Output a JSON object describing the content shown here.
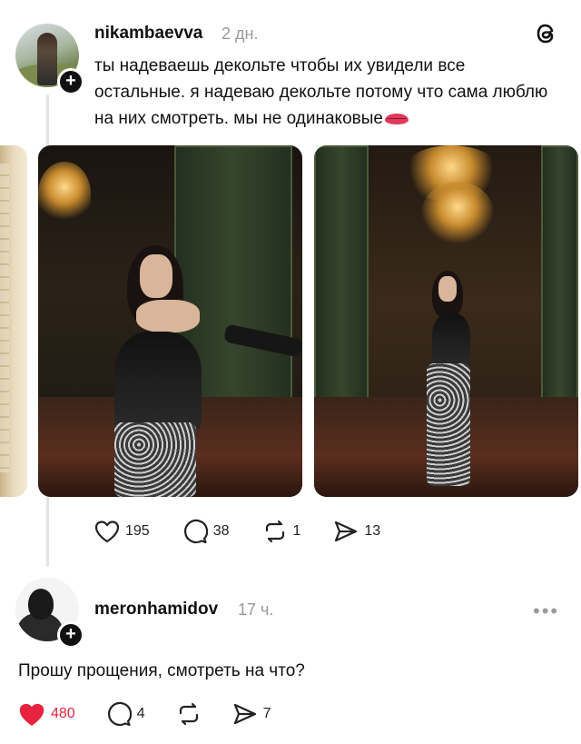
{
  "post": {
    "username": "nikambaevva",
    "time": "2 дн.",
    "text": "ты надеваешь декольте чтобы их увидели все остальные. я надеваю декольте потому что сама люблю на них смотреть. мы не одинаковые",
    "emoji": "lips",
    "likes": "195",
    "replies": "38",
    "reposts": "1",
    "shares": "13"
  },
  "reply": {
    "username": "meronhamidov",
    "time": "17 ч.",
    "text": "Прошу прощения, смотреть на что?",
    "likes": "480",
    "replies": "4",
    "shares": "7",
    "more": "•••"
  },
  "icons": {
    "threads_logo": "threads-logo-icon",
    "heart": "heart-icon",
    "comment": "comment-icon",
    "repost": "repost-icon",
    "share": "share-icon",
    "follow": "plus-icon"
  },
  "colors": {
    "liked_heart": "#e8233f",
    "muted": "#9a9a9a",
    "thread_line": "#e2e2e2"
  },
  "plus_glyph": "+"
}
